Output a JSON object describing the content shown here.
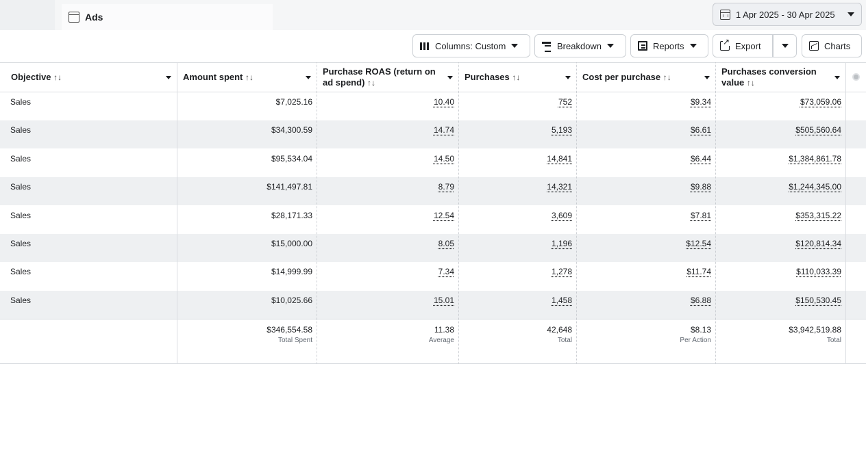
{
  "tab": {
    "label": "Ads",
    "icon": "window-icon"
  },
  "date_range": {
    "label": "1 Apr 2025 - 30 Apr 2025",
    "icon": "calendar-icon"
  },
  "toolbar": {
    "columns_label": "Columns: Custom",
    "breakdown_label": "Breakdown",
    "reports_label": "Reports",
    "export_label": "Export",
    "charts_label": "Charts"
  },
  "columns": [
    {
      "label": "Objective",
      "sort": "↑↓"
    },
    {
      "label": "Amount spent",
      "sort": "↑↓"
    },
    {
      "label": "Purchase ROAS (return on ad spend)",
      "sort": "↑↓"
    },
    {
      "label": "Purchases",
      "sort": "↑↓"
    },
    {
      "label": "Cost per purchase",
      "sort": "↑↓"
    },
    {
      "label": "Purchases conversion value",
      "sort": "↑↓"
    }
  ],
  "rows": [
    [
      "Sales",
      "$7,025.16",
      "10.40",
      "752",
      "$9.34",
      "$73,059.06"
    ],
    [
      "Sales",
      "$34,300.59",
      "14.74",
      "5,193",
      "$6.61",
      "$505,560.64"
    ],
    [
      "Sales",
      "$95,534.04",
      "14.50",
      "14,841",
      "$6.44",
      "$1,384,861.78"
    ],
    [
      "Sales",
      "$141,497.81",
      "8.79",
      "14,321",
      "$9.88",
      "$1,244,345.00"
    ],
    [
      "Sales",
      "$28,171.33",
      "12.54",
      "3,609",
      "$7.81",
      "$353,315.22"
    ],
    [
      "Sales",
      "$15,000.00",
      "8.05",
      "1,196",
      "$12.54",
      "$120,814.34"
    ],
    [
      "Sales",
      "$14,999.99",
      "7.34",
      "1,278",
      "$11.74",
      "$110,033.39"
    ],
    [
      "Sales",
      "$10,025.66",
      "15.01",
      "1,458",
      "$6.88",
      "$150,530.45"
    ]
  ],
  "totals": [
    {
      "value": "",
      "label": ""
    },
    {
      "value": "$346,554.58",
      "label": "Total Spent"
    },
    {
      "value": "11.38",
      "label": "Average"
    },
    {
      "value": "42,648",
      "label": "Total"
    },
    {
      "value": "$8.13",
      "label": "Per Action"
    },
    {
      "value": "$3,942,519.88",
      "label": "Total"
    }
  ]
}
